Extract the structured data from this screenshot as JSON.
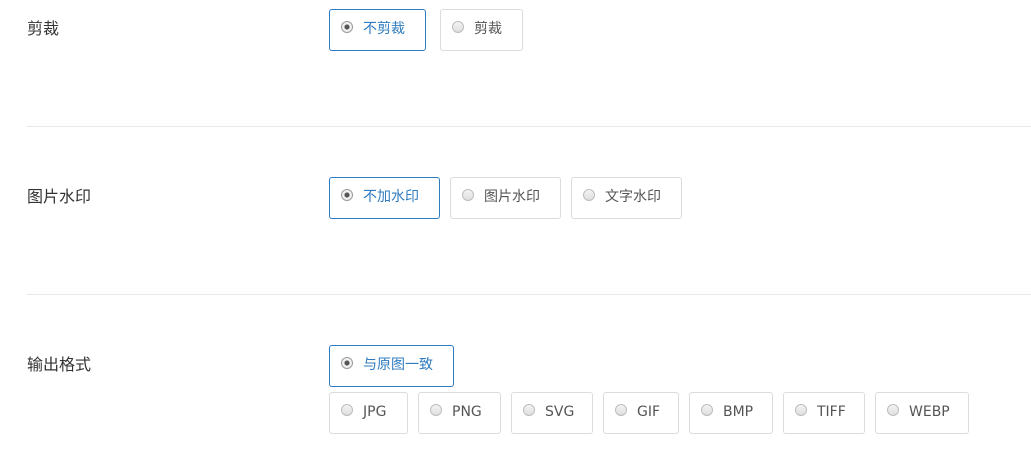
{
  "crop": {
    "label": "剪裁",
    "options": [
      {
        "label": "不剪裁",
        "selected": true
      },
      {
        "label": "剪裁",
        "selected": false
      }
    ]
  },
  "watermark": {
    "label": "图片水印",
    "options": [
      {
        "label": "不加水印",
        "selected": true
      },
      {
        "label": "图片水印",
        "selected": false
      },
      {
        "label": "文字水印",
        "selected": false
      }
    ]
  },
  "output_format": {
    "label": "输出格式",
    "options": [
      {
        "label": "与原图一致",
        "selected": true
      },
      {
        "label": "JPG",
        "selected": false
      },
      {
        "label": "PNG",
        "selected": false
      },
      {
        "label": "SVG",
        "selected": false
      },
      {
        "label": "GIF",
        "selected": false
      },
      {
        "label": "BMP",
        "selected": false
      },
      {
        "label": "TIFF",
        "selected": false
      },
      {
        "label": "WEBP",
        "selected": false
      }
    ]
  },
  "colors": {
    "accent": "#2f7bbf",
    "border": "#dcdcdc",
    "divider": "#e9e9e9"
  }
}
